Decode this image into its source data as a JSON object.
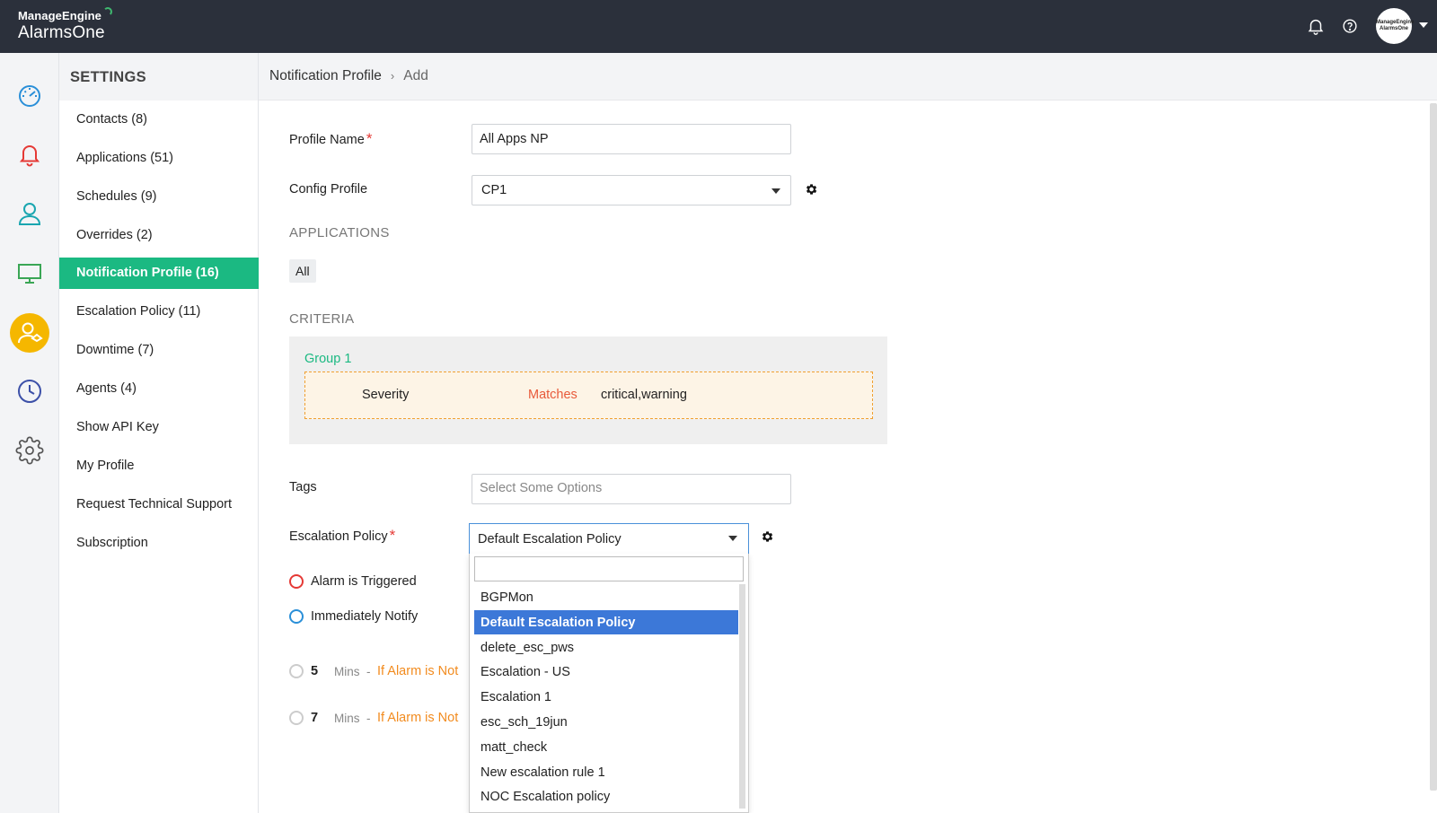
{
  "header": {
    "brand_small": "ManageEngine",
    "brand_big": "AlarmsOne",
    "avatar_line1": "ManageEngine",
    "avatar_line2": "AlarmsOne"
  },
  "rail": {
    "icons": [
      "dashboard-icon",
      "alarm-bell-icon",
      "user-icon",
      "monitor-icon",
      "user-settings-icon",
      "clock-icon",
      "gear-icon"
    ],
    "active_color": "#f5b700"
  },
  "settings": {
    "title": "SETTINGS",
    "items": [
      {
        "label": "Contacts (8)"
      },
      {
        "label": "Applications (51)"
      },
      {
        "label": "Schedules (9)"
      },
      {
        "label": "Overrides (2)"
      },
      {
        "label": "Notification Profile (16)"
      },
      {
        "label": "Escalation Policy (11)"
      },
      {
        "label": "Downtime (7)"
      },
      {
        "label": "Agents (4)"
      },
      {
        "label": "Show API Key"
      },
      {
        "label": "My Profile"
      },
      {
        "label": "Request Technical Support"
      },
      {
        "label": "Subscription"
      }
    ],
    "active_index": 4,
    "active_color": "#1bb982"
  },
  "breadcrumb": {
    "parent": "Notification Profile",
    "separator": "›",
    "current": "Add"
  },
  "form": {
    "profile_name_label": "Profile Name",
    "profile_name_value": "All Apps NP",
    "required_mark": "*",
    "config_profile_label": "Config Profile",
    "config_profile_value": "CP1",
    "applications_title": "APPLICATIONS",
    "applications_chip": "All",
    "criteria_title": "CRITERIA",
    "group_title": "Group 1",
    "criteria_field": "Severity",
    "criteria_operator": "Matches",
    "criteria_value": "critical,warning",
    "tags_label": "Tags",
    "tags_placeholder": "Select Some Options",
    "escalation_label": "Escalation Policy",
    "escalation_value": "Default Escalation Policy"
  },
  "escalation_steps": {
    "triggered_label": "Alarm is Triggered",
    "immediate_label": "Immediately Notify",
    "steps": [
      {
        "num": "5",
        "unit": "Mins",
        "dash": "-",
        "condition": "If Alarm is Not"
      },
      {
        "num": "7",
        "unit": "Mins",
        "dash": "-",
        "condition": "If Alarm is Not"
      }
    ]
  },
  "dropdown": {
    "search_value": "",
    "options": [
      {
        "label": "BGPMon"
      },
      {
        "label": "Default Escalation Policy"
      },
      {
        "label": "delete_esc_pws"
      },
      {
        "label": "Escalation - US"
      },
      {
        "label": "Escalation 1"
      },
      {
        "label": "esc_sch_19jun"
      },
      {
        "label": "matt_check"
      },
      {
        "label": "New escalation rule 1"
      },
      {
        "label": "NOC Escalation policy"
      }
    ],
    "selected_index": 1,
    "selected_color": "#3c78d8"
  }
}
